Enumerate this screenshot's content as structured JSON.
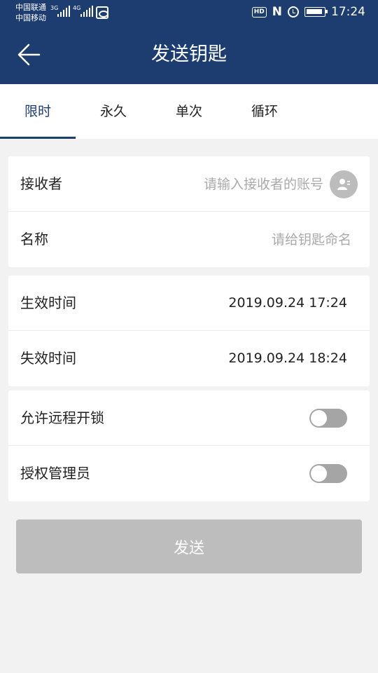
{
  "status_bar": {
    "carrier1": "中国联通",
    "carrier2": "中国移动",
    "net1": "3G",
    "net2": "4G",
    "hd": "HD",
    "nfc": "N",
    "time": "17:24"
  },
  "header": {
    "title": "发送钥匙",
    "back_icon": "arrow-left-icon"
  },
  "tabs": [
    {
      "label": "限时",
      "active": true
    },
    {
      "label": "永久",
      "active": false
    },
    {
      "label": "单次",
      "active": false
    },
    {
      "label": "循环",
      "active": false
    }
  ],
  "form": {
    "recipient": {
      "label": "接收者",
      "placeholder": "请输入接收者的账号",
      "value": "",
      "icon": "contact-icon"
    },
    "name": {
      "label": "名称",
      "placeholder": "请给钥匙命名",
      "value": ""
    },
    "start_time": {
      "label": "生效时间",
      "value": "2019.09.24 17:24"
    },
    "end_time": {
      "label": "失效时间",
      "value": "2019.09.24 18:24"
    },
    "remote_unlock": {
      "label": "允许远程开锁",
      "enabled": false
    },
    "admin": {
      "label": "授权管理员",
      "enabled": false
    }
  },
  "send_button": {
    "label": "发送",
    "enabled": false
  },
  "colors": {
    "header_bg": "#1d3c6f",
    "page_bg": "#f2f2f2",
    "button_disabled": "#bdbdbd",
    "toggle_off": "#a5a5a5"
  }
}
